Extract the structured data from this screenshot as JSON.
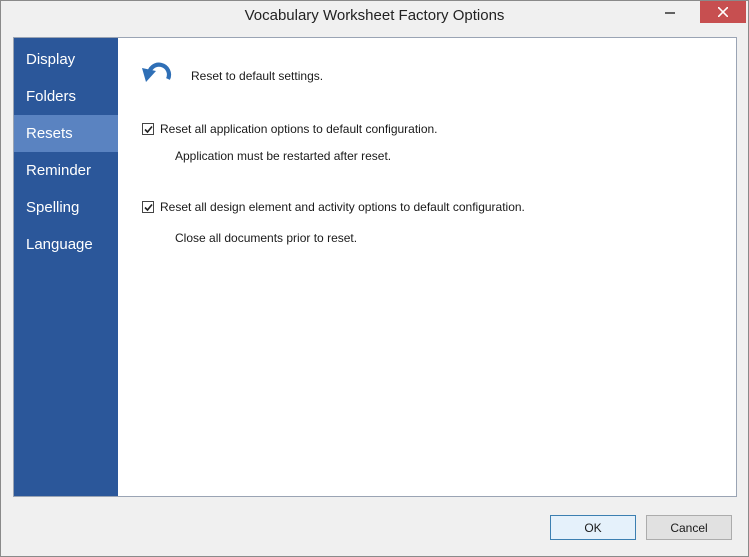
{
  "window": {
    "title": "Vocabulary Worksheet Factory Options",
    "controls": {
      "minimize_icon": "minimize-icon",
      "close_icon": "close-icon",
      "close_color": "#c74f50"
    }
  },
  "sidebar": {
    "background": "#2b579a",
    "active_background": "#5a83c1",
    "items": [
      {
        "label": "Display",
        "active": false
      },
      {
        "label": "Folders",
        "active": false
      },
      {
        "label": "Resets",
        "active": true
      },
      {
        "label": "Reminder",
        "active": false
      },
      {
        "label": "Spelling",
        "active": false
      },
      {
        "label": "Language",
        "active": false
      }
    ]
  },
  "main": {
    "icon": "reset-undo-icon",
    "heading": "Reset to default settings.",
    "options": [
      {
        "label": "Reset all application options to default configuration.",
        "checked": true,
        "note": "Application must be restarted after reset."
      },
      {
        "label": "Reset all design element and activity options to default configuration.",
        "checked": true,
        "note": "Close all documents prior to reset."
      }
    ]
  },
  "footer": {
    "ok_label": "OK",
    "cancel_label": "Cancel"
  }
}
